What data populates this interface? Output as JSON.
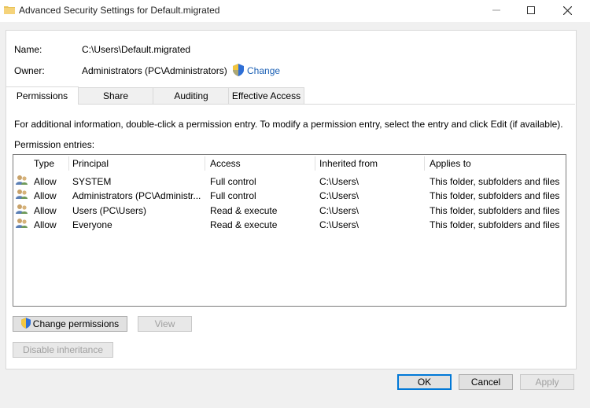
{
  "window": {
    "title": "Advanced Security Settings for Default.migrated"
  },
  "info": {
    "name_label": "Name:",
    "name_value": "C:\\Users\\Default.migrated",
    "owner_label": "Owner:",
    "owner_value": "Administrators (PC\\Administrators)",
    "change_link": "Change"
  },
  "tabs": [
    {
      "label": "Permissions",
      "active": true
    },
    {
      "label": "Share",
      "active": false
    },
    {
      "label": "Auditing",
      "active": false
    },
    {
      "label": "Effective Access",
      "active": false
    }
  ],
  "instructions": "For additional information, double-click a permission entry. To modify a permission entry, select the entry and click Edit (if available).",
  "entries_label": "Permission entries:",
  "table": {
    "columns": [
      "Type",
      "Principal",
      "Access",
      "Inherited from",
      "Applies to"
    ],
    "rows": [
      [
        "Allow",
        "SYSTEM",
        "Full control",
        "C:\\Users\\",
        "This folder, subfolders and files"
      ],
      [
        "Allow",
        "Administrators (PC\\Administr...",
        "Full control",
        "C:\\Users\\",
        "This folder, subfolders and files"
      ],
      [
        "Allow",
        "Users (PC\\Users)",
        "Read & execute",
        "C:\\Users\\",
        "This folder, subfolders and files"
      ],
      [
        "Allow",
        "Everyone",
        "Read & execute",
        "C:\\Users\\",
        "This folder, subfolders and files"
      ]
    ]
  },
  "buttons": {
    "change_permissions": "Change permissions",
    "view": "View",
    "disable_inheritance": "Disable inheritance",
    "ok": "OK",
    "cancel": "Cancel",
    "apply": "Apply"
  },
  "icons": {
    "folder": "folder-icon",
    "shield": "uac-shield-icon",
    "user": "users-icon"
  }
}
